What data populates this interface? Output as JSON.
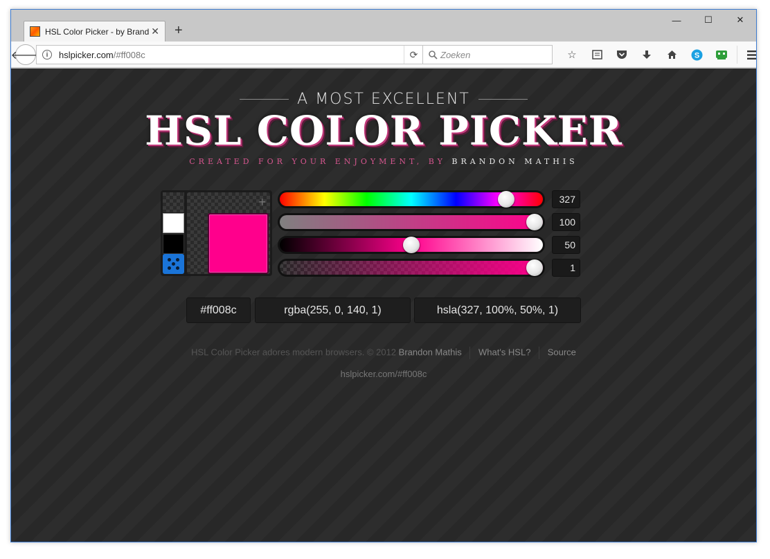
{
  "browser": {
    "tab_title": "HSL Color Picker - by Brandon",
    "url_host": "hslpicker.com",
    "url_path": "/#ff008c",
    "search_placeholder": "Zoeken",
    "win_minimize": "—",
    "win_maximize": "☐",
    "win_close": "✕",
    "tab_close": "✕",
    "new_tab": "+"
  },
  "header": {
    "tagline": "A MOST EXCELLENT",
    "title": "HSL COLOR PICKER",
    "byline_prefix": "CREATED FOR YOUR ENJOYMENT, BY",
    "byline_author": "BRANDON MATHIS"
  },
  "picker": {
    "preview_color": "#ff008c",
    "swatches": [
      "white",
      "black",
      "random-dice"
    ],
    "sliders": [
      {
        "name": "hue",
        "value": "327",
        "fraction": 0.886
      },
      {
        "name": "saturation",
        "value": "100",
        "fraction": 1.0
      },
      {
        "name": "lightness",
        "value": "50",
        "fraction": 0.5
      },
      {
        "name": "alpha",
        "value": "1",
        "fraction": 1.0
      }
    ]
  },
  "codes": {
    "hex": "#ff008c",
    "rgba": "rgba(255, 0, 140, 1)",
    "hsla": "hsla(327, 100%, 50%, 1)"
  },
  "footer": {
    "text": "HSL Color Picker adores modern browsers. © 2012",
    "author_link": "Brandon Mathis",
    "whats_hsl_link": "What's HSL?",
    "source_link": "Source",
    "url": "hslpicker.com/#ff008c"
  },
  "colors": {
    "accent": "#ff008c",
    "page_background": "#2b2b2b",
    "dice": "#1a74d8"
  }
}
